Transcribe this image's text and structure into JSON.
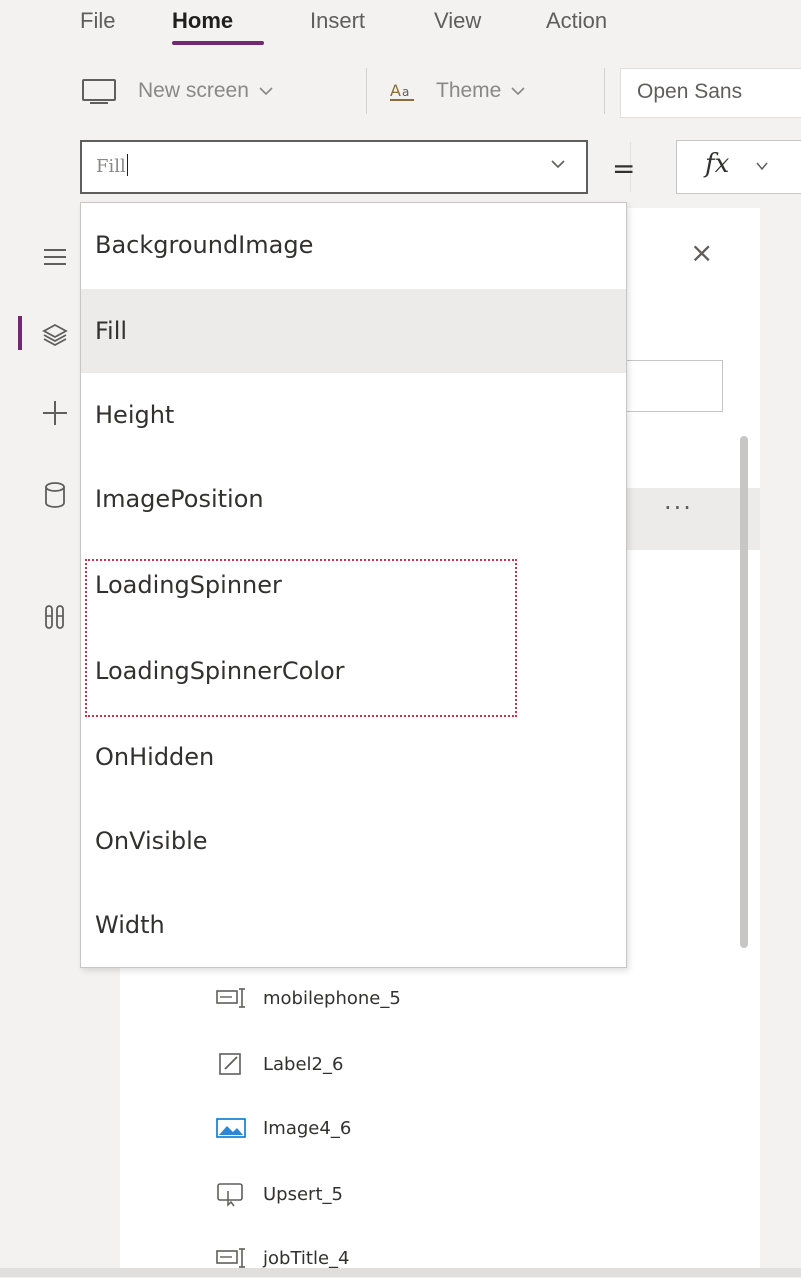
{
  "menu": {
    "items": [
      "File",
      "Home",
      "Insert",
      "View",
      "Action"
    ],
    "active": "Home"
  },
  "toolbar": {
    "new_screen_label": "New screen",
    "theme_label": "Theme",
    "font_value": "Open Sans"
  },
  "formula_bar": {
    "property_value": "Fill",
    "equals": "=",
    "fx_label": "fx"
  },
  "dropdown": {
    "options": [
      "BackgroundImage",
      "Fill",
      "Height",
      "ImagePosition",
      "LoadingSpinner",
      "LoadingSpinnerColor",
      "OnHidden",
      "OnVisible",
      "Width"
    ],
    "selected": "Fill"
  },
  "tree": {
    "close_label": "×",
    "ellipsis": "···",
    "items": [
      {
        "label": "mobilephone_5",
        "icon": "text-input-icon"
      },
      {
        "label": "Label2_6",
        "icon": "edit-label-icon"
      },
      {
        "label": "Image4_6",
        "icon": "image-icon"
      },
      {
        "label": "Upsert_5",
        "icon": "button-icon"
      },
      {
        "label": "jobTitle_4",
        "icon": "text-input-icon"
      }
    ]
  },
  "colors": {
    "accent": "#742774",
    "highlight_border": "#c8334f"
  }
}
